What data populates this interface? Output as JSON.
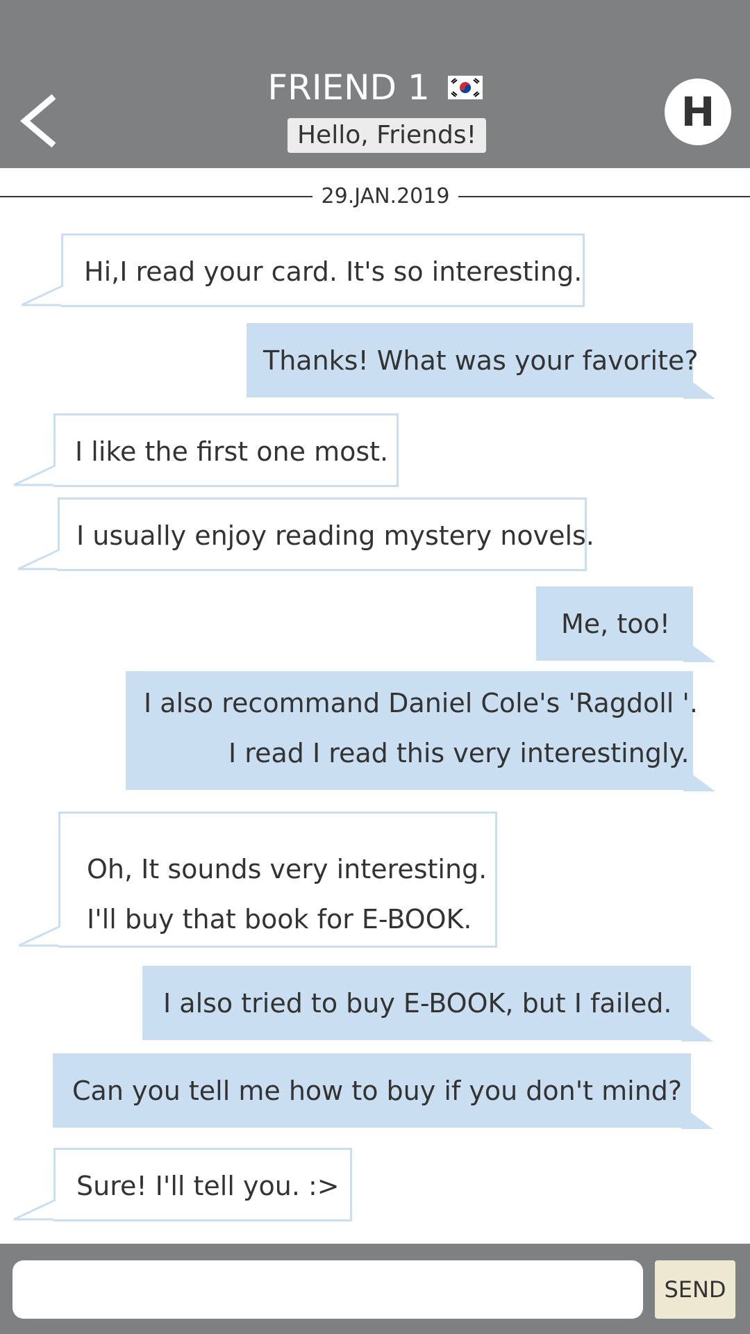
{
  "header": {
    "title": "FRIEND 1",
    "flag_icon": "south-korea-flag-icon",
    "status": "Hello, Friends!",
    "avatar_letter": "H",
    "back_icon": "chevron-left-icon",
    "bg_color": "#7f8082"
  },
  "date": "29.JAN.2019",
  "messages": [
    {
      "side": "in",
      "lines": [
        "Hi,I read your card. It's so interesting."
      ]
    },
    {
      "side": "out",
      "lines": [
        "Thanks! What was your favorite?"
      ]
    },
    {
      "side": "in",
      "lines": [
        "I like the first one most."
      ]
    },
    {
      "side": "in",
      "lines": [
        "I usually enjoy reading mystery novels."
      ]
    },
    {
      "side": "out",
      "lines": [
        "Me, too!"
      ]
    },
    {
      "side": "out",
      "lines": [
        "I also recommand Daniel Cole's 'Ragdoll '.",
        "I read I read this very interestingly."
      ]
    },
    {
      "side": "in",
      "lines": [
        "Oh, It sounds very interesting.",
        "I'll buy that book for E-BOOK."
      ]
    },
    {
      "side": "out",
      "lines": [
        "I also tried to buy E-BOOK, but I failed."
      ]
    },
    {
      "side": "out",
      "lines": [
        "Can you tell me how to buy if you don't mind?"
      ]
    },
    {
      "side": "in",
      "lines": [
        "Sure! I'll tell you. :>"
      ]
    }
  ],
  "composer": {
    "input_value": "",
    "send_label": "SEND"
  },
  "colors": {
    "incoming_border": "#c9def0",
    "outgoing_fill": "#c9def0",
    "send_button": "#efe8d1"
  }
}
